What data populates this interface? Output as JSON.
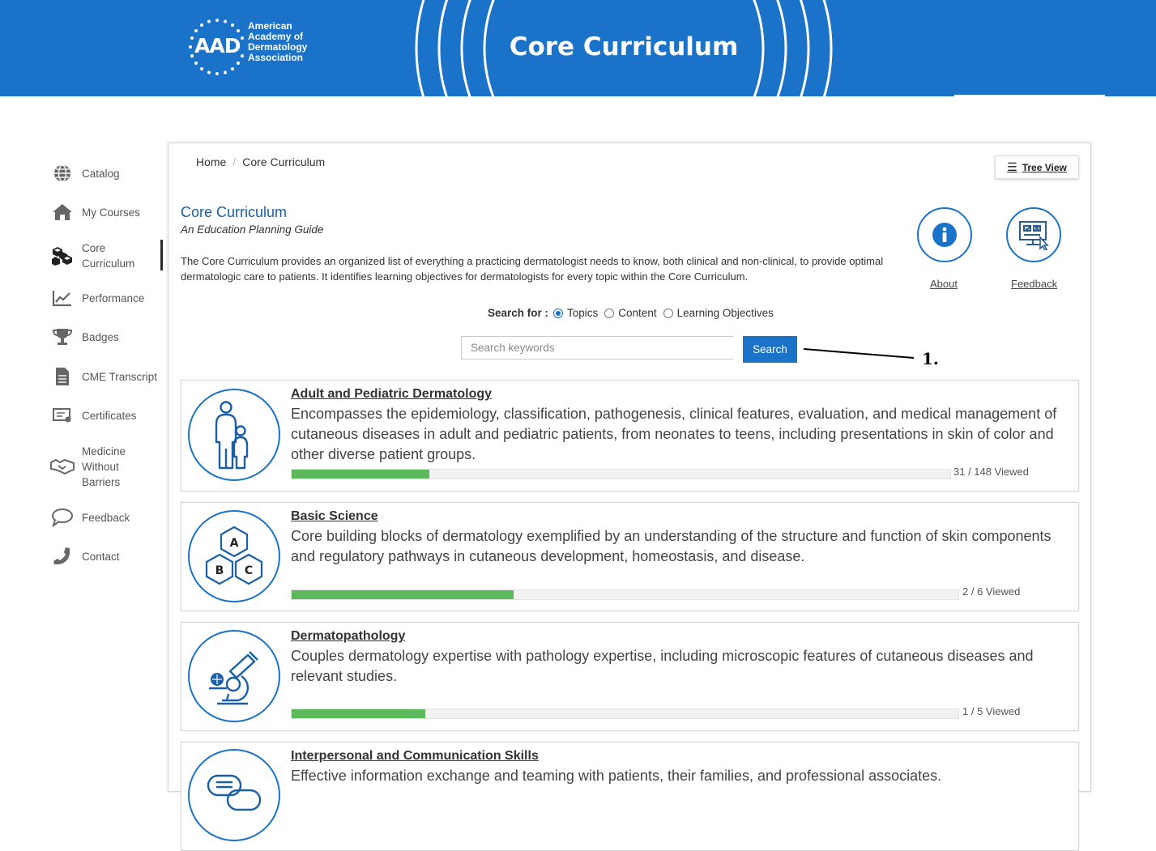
{
  "banner": {
    "logo_mark": "AAD",
    "logo_lines": [
      "American",
      "Academy of",
      "Dermatology",
      "Association"
    ],
    "title": "Core Curriculum",
    "colors": {
      "brand": "#1a73c9"
    }
  },
  "sidebar": {
    "items": [
      {
        "label": "Catalog",
        "icon": "globe-icon"
      },
      {
        "label": "My Courses",
        "icon": "home-icon"
      },
      {
        "label": "Core Curriculum",
        "icon": "cubes-icon",
        "active": true
      },
      {
        "label": "Performance",
        "icon": "chart-line-icon"
      },
      {
        "label": "Badges",
        "icon": "trophy-icon"
      },
      {
        "label": "CME Transcript",
        "icon": "document-icon"
      },
      {
        "label": "Certificates",
        "icon": "certificate-icon"
      },
      {
        "label": "Medicine Without Barriers",
        "icon": "handshake-icon"
      },
      {
        "label": "Feedback",
        "icon": "chat-bubble-icon"
      },
      {
        "label": "Contact",
        "icon": "phone-icon"
      }
    ]
  },
  "main": {
    "breadcrumb": {
      "home": "Home",
      "current": "Core Curriculum"
    },
    "tree_view_label": "Tree View",
    "title": "Core Curriculum",
    "subtitle": "An Education Planning Guide",
    "description": "The Core Curriculum provides an organized list of everything a practicing dermatologist needs to know, both clinical and non-clinical, to provide optimal dermatologic care to patients. It identifies learning objectives for dermatologists for every topic within the Core Curriculum.",
    "about_label": "About",
    "feedback_label": "Feedback",
    "search": {
      "for_label": "Search for :",
      "options": [
        "Topics",
        "Content",
        "Learning Objectives"
      ],
      "selected": "Topics",
      "placeholder": "Search keywords",
      "button": "Search"
    },
    "topics": [
      {
        "title": "Adult and Pediatric Dermatology",
        "description": "Encompasses the epidemiology, classification, pathogenesis, clinical features, evaluation, and medical management of cutaneous diseases in adult and pediatric patients, from neonates to teens, including presentations in skin of color and other diverse patient groups.",
        "viewed_text": "31 / 148 Viewed",
        "progress": 0.209,
        "icon": "adult-child-icon"
      },
      {
        "title": "Basic Science",
        "description": "Core building blocks of dermatology exemplified by an understanding of the structure and function of skin components and regulatory pathways in cutaneous development, homeostasis, and disease.",
        "viewed_text": "2 / 6 Viewed",
        "progress": 0.333,
        "icon": "abc-blocks-icon",
        "icon_letters": [
          "A",
          "B",
          "C"
        ]
      },
      {
        "title": "Dermatopathology",
        "description": "Couples dermatology expertise with pathology expertise, including microscopic features of cutaneous diseases and relevant studies.",
        "viewed_text": "1 / 5 Viewed",
        "progress": 0.2,
        "icon": "microscope-icon"
      },
      {
        "title": "Interpersonal and Communication Skills",
        "description": "Effective information exchange and teaming with patients, their families, and professional associates.",
        "icon": "speech-bubbles-icon"
      }
    ]
  },
  "annotation": {
    "label": "1."
  }
}
